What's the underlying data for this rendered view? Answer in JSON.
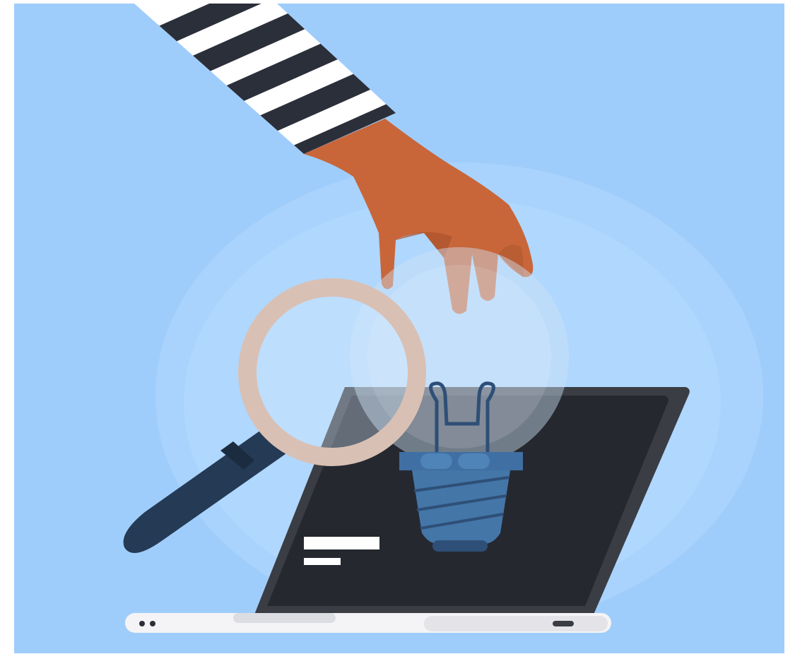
{
  "illustration": {
    "colors": {
      "frame": "#ffffff",
      "background": "#9fcdfb",
      "glow": "#b8dcfd",
      "sleeve_light": "#ffffff",
      "sleeve_dark": "#2b2f3a",
      "skin": "#c8663a",
      "skin_shadow": "#a9532c",
      "lens_ring": "#d9c0b4",
      "handle": "#243a55",
      "laptop_frame": "#3a3d44",
      "laptop_screen": "#262830",
      "laptop_base": "#f4f4f6",
      "bulb_glass": "#cfe3f6",
      "bulb_base": "#4476a8",
      "bulb_collar": "#3f6fa3",
      "filament": "#2e4f77",
      "text_bar": "#ffffff"
    },
    "icons": [
      "hand",
      "magnifying-glass",
      "light-bulb",
      "laptop"
    ]
  }
}
